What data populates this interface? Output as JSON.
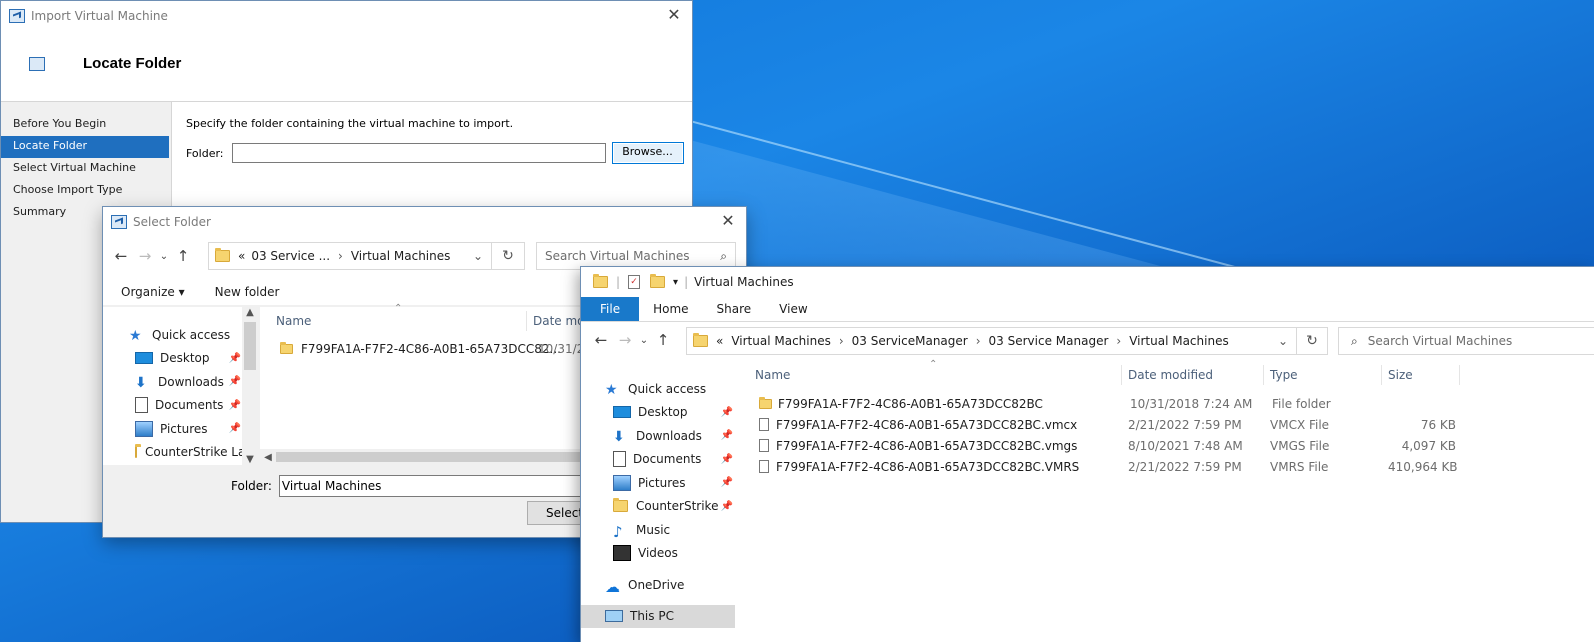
{
  "import_wizard": {
    "title": "Import Virtual Machine",
    "header_title": "Locate Folder",
    "nav": [
      "Before You Begin",
      "Locate Folder",
      "Select Virtual Machine",
      "Choose Import Type",
      "Summary"
    ],
    "selected_nav": 1,
    "instruction": "Specify the folder containing the virtual machine to import.",
    "folder_label": "Folder:",
    "folder_value": "",
    "browse_label": "Browse..."
  },
  "select_folder": {
    "title": "Select Folder",
    "breadcrumb": [
      "«",
      "03 Service ...",
      "Virtual Machines"
    ],
    "search_placeholder": "Search Virtual Machines",
    "toolbar": {
      "organize": "Organize",
      "new_folder": "New folder"
    },
    "tree": [
      "Quick access",
      "Desktop",
      "Downloads",
      "Documents",
      "Pictures",
      "CounterStrike La"
    ],
    "columns": {
      "name": "Name",
      "date": "Date mo"
    },
    "rows": [
      {
        "name": "F799FA1A-F7F2-4C86-A0B1-65A73DCC82...",
        "date": "10/31/20"
      }
    ],
    "folder_label": "Folder:",
    "folder_value": "Virtual Machines",
    "select_button": "Select"
  },
  "explorer": {
    "title": "Virtual Machines",
    "ribbon_tabs": [
      "File",
      "Home",
      "Share",
      "View"
    ],
    "breadcrumb": [
      "«",
      "Virtual Machines",
      "03 ServiceManager",
      "03 Service Manager",
      "Virtual Machines"
    ],
    "search_placeholder": "Search Virtual Machines",
    "tree": [
      {
        "label": "Quick access",
        "icon": "quick-access-icon",
        "pinned": false
      },
      {
        "label": "Desktop",
        "icon": "desktop-icon",
        "pinned": true
      },
      {
        "label": "Downloads",
        "icon": "downloads-icon",
        "pinned": true
      },
      {
        "label": "Documents",
        "icon": "documents-icon",
        "pinned": true
      },
      {
        "label": "Pictures",
        "icon": "pictures-icon",
        "pinned": true
      },
      {
        "label": "CounterStrike La",
        "icon": "folder-icon",
        "pinned": true
      },
      {
        "label": "Music",
        "icon": "music-icon",
        "pinned": false
      },
      {
        "label": "Videos",
        "icon": "videos-icon",
        "pinned": false
      },
      {
        "label": "OneDrive",
        "icon": "onedrive-icon",
        "pinned": false
      },
      {
        "label": "This PC",
        "icon": "this-pc-icon",
        "pinned": false
      }
    ],
    "columns": {
      "name": "Name",
      "date": "Date modified",
      "type": "Type",
      "size": "Size"
    },
    "files": [
      {
        "name": "F799FA1A-F7F2-4C86-A0B1-65A73DCC82BC",
        "date": "10/31/2018 7:24 AM",
        "type": "File folder",
        "size": "",
        "kind": "folder"
      },
      {
        "name": "F799FA1A-F7F2-4C86-A0B1-65A73DCC82BC.vmcx",
        "date": "2/21/2022 7:59 PM",
        "type": "VMCX File",
        "size": "76 KB",
        "kind": "file"
      },
      {
        "name": "F799FA1A-F7F2-4C86-A0B1-65A73DCC82BC.vmgs",
        "date": "8/10/2021 7:48 AM",
        "type": "VMGS File",
        "size": "4,097 KB",
        "kind": "file"
      },
      {
        "name": "F799FA1A-F7F2-4C86-A0B1-65A73DCC82BC.VMRS",
        "date": "2/21/2022 7:59 PM",
        "type": "VMRS File",
        "size": "410,964 KB",
        "kind": "file"
      }
    ]
  }
}
